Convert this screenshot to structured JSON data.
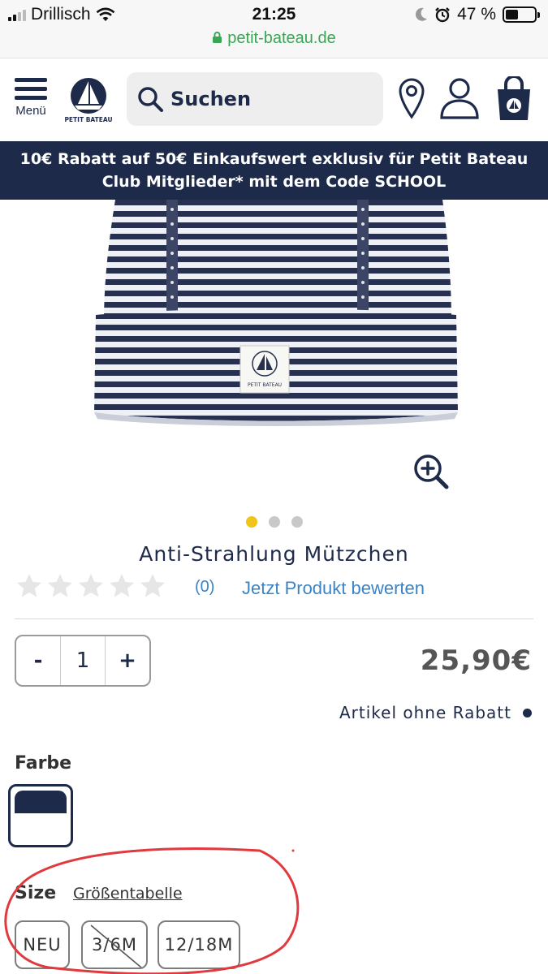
{
  "status_bar": {
    "carrier": "Drillisch",
    "time": "21:25",
    "battery": "47 %",
    "url": "petit-bateau.de"
  },
  "header": {
    "menu_label": "Menü",
    "search_placeholder": "Suchen",
    "icons": [
      "menu-icon",
      "location-pin-icon",
      "user-icon",
      "shopping-bag-icon",
      "search-icon",
      "wifi-icon",
      "moon-icon",
      "alarm-icon",
      "lock-icon"
    ]
  },
  "promo": {
    "line1": "10€ Rabatt auf 50€ Einkaufswert exklusiv für Petit Bateau",
    "line2": "Club Mitglieder* mit dem Code SCHOOL"
  },
  "carousel": {
    "count": 3,
    "active": 1
  },
  "product": {
    "title": "Anti-Strahlung Mützchen",
    "rating_count": "(0)",
    "rate_link": "Jetzt Produkt bewerten",
    "rating_value": 0,
    "rating_max": 5,
    "quantity": {
      "minus": "-",
      "value": "1",
      "plus": "+"
    },
    "price": "25,90€",
    "no_discount": "Artikel ohne Rabatt"
  },
  "color": {
    "label": "Farbe",
    "selected_swatch_colors": [
      "#1e2a4a",
      "#ffffff"
    ]
  },
  "size": {
    "label": "Size",
    "table_link": "Größentabelle",
    "options": [
      {
        "label": "NEU",
        "available": true
      },
      {
        "label": "3/6M",
        "available": false
      },
      {
        "label": "12/18M",
        "available": true
      }
    ]
  },
  "colors": {
    "navy": "#1e2a4a",
    "link_blue": "#3a84c6",
    "url_green": "#3aa655",
    "accent_yellow": "#f0c419",
    "annotation_red": "#e0393e"
  }
}
